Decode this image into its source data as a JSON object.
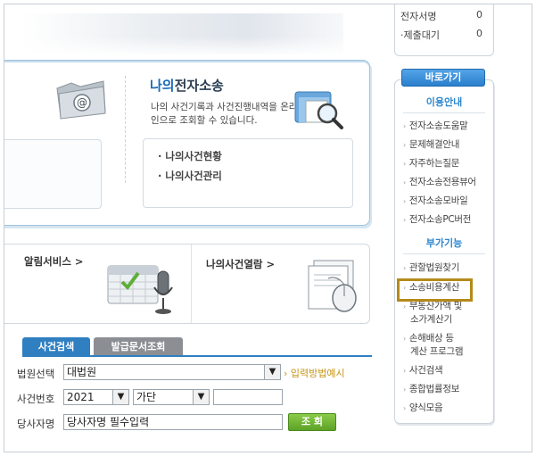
{
  "stats": [
    {
      "label": "전자서명",
      "value": "0"
    },
    {
      "label": "제출대기",
      "value": "0"
    }
  ],
  "litigation": {
    "title_prefix": "나의",
    "title_main": "전자소송",
    "desc": "나의 사건기록과 사건진행내역을 온라인으로 조회할 수 있습니다.",
    "items": [
      "· 나의사건현황",
      "· 나의사건관리"
    ]
  },
  "services": {
    "alarm": "알림서비스 >",
    "view": "나의사건열람 >"
  },
  "tabs": {
    "case_search": "사건검색",
    "doc_search": "발급문서조회"
  },
  "form": {
    "court_label": "법원선택",
    "court_value": "대법원",
    "howto": "› 입력방법예시",
    "case_label": "사건번호",
    "year_value": "2021",
    "type_value": "가단",
    "party_label": "당사자명",
    "party_placeholder": "당사자명 필수입력",
    "query_button": "조 회"
  },
  "sidebar": {
    "shortcut": "바로가기",
    "section1": "이용안내",
    "items1": [
      "전자소송도움말",
      "문제해결안내",
      "자주하는질문",
      "전자소송전용뷰어",
      "전자소송모바일",
      "전자소송PC버전"
    ],
    "section2": "부가기능",
    "items2": [
      "관할법원찾기",
      "소송비용계산",
      "부동산가액 및",
      "소가계산기",
      "손해배상 등",
      "계산 프로그램",
      "사건검색",
      "종합법률정보",
      "양식모음"
    ]
  },
  "colors": {
    "accent_blue": "#2f7fc1",
    "highlight": "#b58a1a",
    "query_green": "#5da226"
  }
}
